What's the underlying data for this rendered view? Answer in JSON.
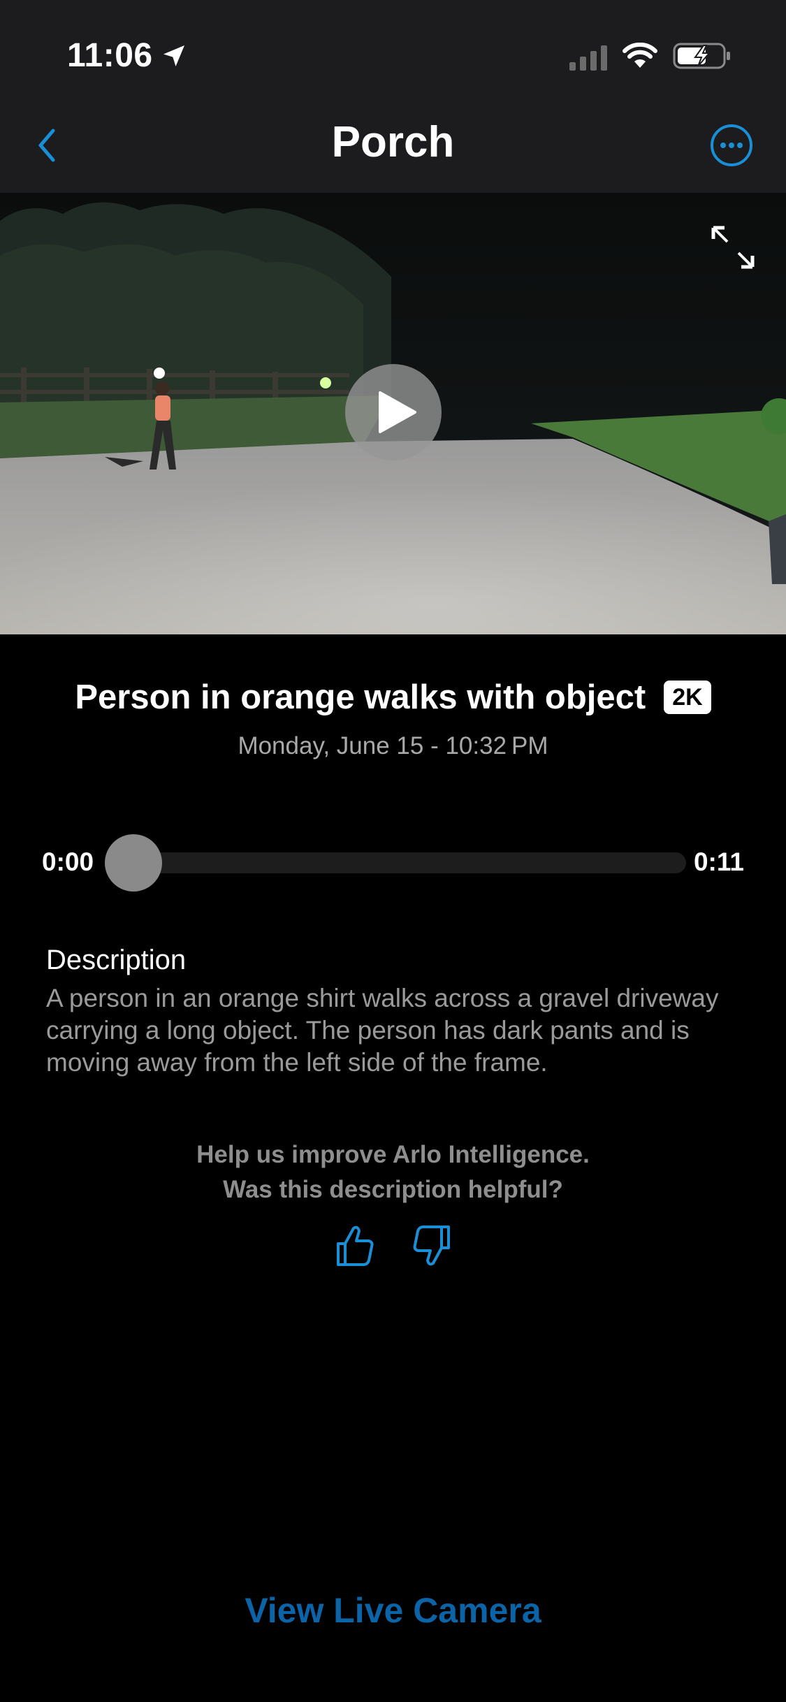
{
  "status_bar": {
    "time": "11:06",
    "icons": [
      "location-arrow-icon",
      "signal-icon",
      "wifi-icon",
      "battery-charging-icon"
    ]
  },
  "header": {
    "title": "Porch",
    "back_icon": "chevron-left-icon",
    "more_icon": "ellipsis-circle-icon",
    "accent_color": "#1a8fd6"
  },
  "video": {
    "expand_icon": "expand-icon",
    "play_icon": "play-icon"
  },
  "event": {
    "title": "Person in orange walks with object",
    "quality_badge": "2K",
    "date": "Monday, June 15 - 10:32 PM"
  },
  "playback": {
    "current_time": "0:00",
    "duration": "0:11",
    "progress": 0
  },
  "description": {
    "heading": "Description",
    "body": "A person in an orange shirt walks across a gravel driveway carrying a long object. The person has dark pants and is moving away from the left side of the frame."
  },
  "feedback": {
    "line1": "Help us improve Arlo Intelligence.",
    "line2": "Was this description helpful?",
    "like_icon": "thumbs-up-icon",
    "dislike_icon": "thumbs-down-icon"
  },
  "footer": {
    "live_label": "View Live Camera",
    "live_color": "#0b63a8"
  }
}
